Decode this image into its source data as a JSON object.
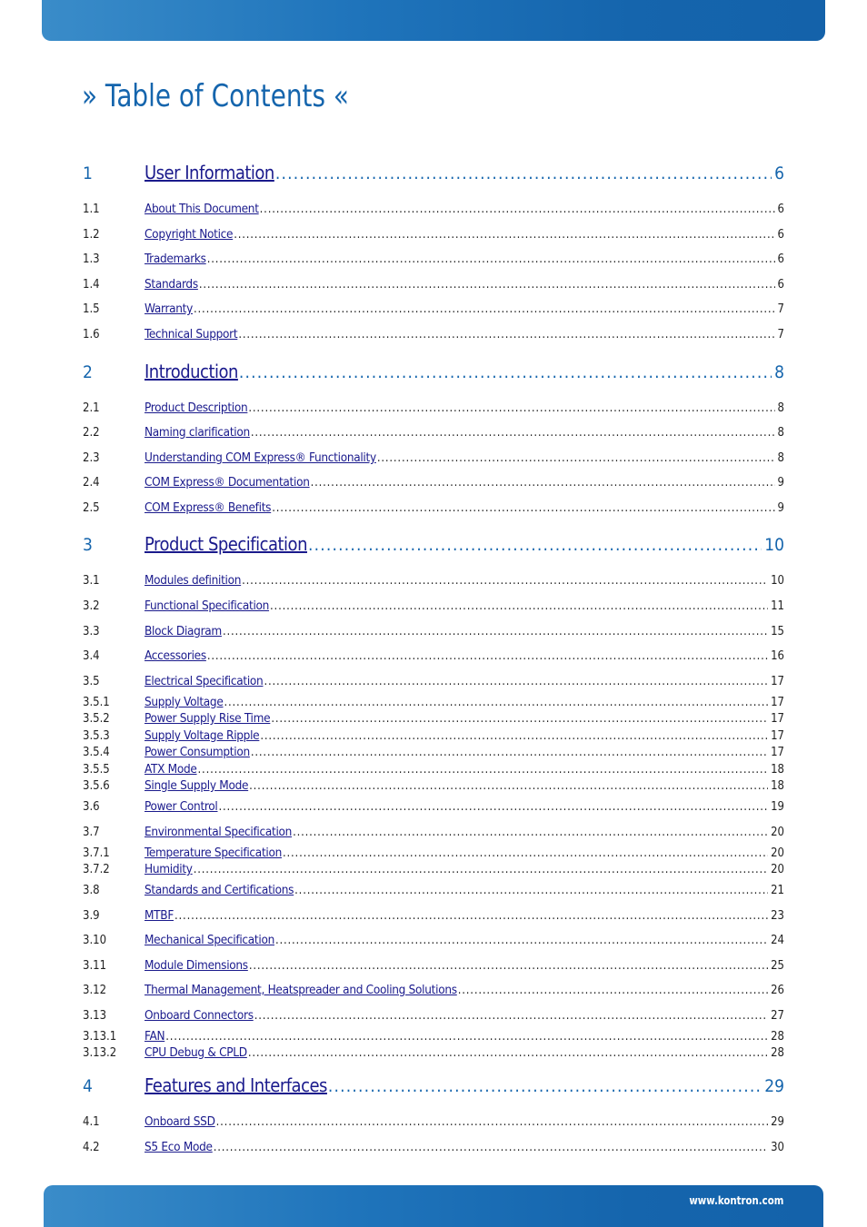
{
  "header": {
    "title": "» Table of Contents «"
  },
  "footer": {
    "url": "www.kontron.com"
  },
  "toc": [
    {
      "num": "1",
      "title": "User Information",
      "page": "6",
      "level": 1
    },
    {
      "num": "1.1",
      "title": "About This Document",
      "page": "6",
      "level": 2
    },
    {
      "num": "1.2",
      "title": "Copyright Notice",
      "page": "6",
      "level": 2
    },
    {
      "num": "1.3",
      "title": "Trademarks",
      "page": "6",
      "level": 2
    },
    {
      "num": "1.4",
      "title": "Standards",
      "page": "6",
      "level": 2
    },
    {
      "num": "1.5",
      "title": "Warranty",
      "page": "7",
      "level": 2
    },
    {
      "num": "1.6",
      "title": "Technical Support",
      "page": "7",
      "level": 2
    },
    {
      "num": "2",
      "title": "Introduction",
      "page": "8",
      "level": 1
    },
    {
      "num": "2.1",
      "title": "Product Description",
      "page": "8",
      "level": 2
    },
    {
      "num": "2.2",
      "title": "Naming clarification",
      "page": "8",
      "level": 2
    },
    {
      "num": "2.3",
      "title": "Understanding COM Express® Functionality",
      "page": "8",
      "level": 2
    },
    {
      "num": "2.4",
      "title": "COM Express® Documentation",
      "page": "9",
      "level": 2
    },
    {
      "num": "2.5",
      "title": "COM Express® Benefits",
      "page": "9",
      "level": 2
    },
    {
      "num": "3",
      "title": "Product Specification",
      "page": "10",
      "level": 1
    },
    {
      "num": "3.1",
      "title": "Modules definition",
      "page": "10",
      "level": 2
    },
    {
      "num": "3.2",
      "title": "Functional Specification",
      "page": "11",
      "level": 2
    },
    {
      "num": "3.3",
      "title": "Block Diagram",
      "page": "15",
      "level": 2
    },
    {
      "num": "3.4",
      "title": "Accessories",
      "page": "16",
      "level": 2
    },
    {
      "num": "3.5",
      "title": "Electrical Specification",
      "page": "17",
      "level": 2
    },
    {
      "num": "3.5.1",
      "title": "Supply Voltage",
      "page": "17",
      "level": 3
    },
    {
      "num": "3.5.2",
      "title": "Power Supply Rise Time",
      "page": "17",
      "level": 3
    },
    {
      "num": "3.5.3",
      "title": "Supply Voltage Ripple",
      "page": "17",
      "level": 3
    },
    {
      "num": "3.5.4",
      "title": "Power Consumption",
      "page": "17",
      "level": 3
    },
    {
      "num": "3.5.5",
      "title": "ATX Mode",
      "page": "18",
      "level": 3
    },
    {
      "num": "3.5.6",
      "title": "Single Supply Mode",
      "page": "18",
      "level": 3
    },
    {
      "num": "3.6",
      "title": "Power Control",
      "page": "19",
      "level": 2
    },
    {
      "num": "3.7",
      "title": "Environmental Specification",
      "page": "20",
      "level": 2
    },
    {
      "num": "3.7.1",
      "title": "Temperature Specification",
      "page": "20",
      "level": 3
    },
    {
      "num": "3.7.2",
      "title": "Humidity",
      "page": "20",
      "level": 3
    },
    {
      "num": "3.8",
      "title": "Standards and Certifications",
      "page": "21",
      "level": 2
    },
    {
      "num": "3.9",
      "title": "MTBF",
      "page": "23",
      "level": 2
    },
    {
      "num": "3.10",
      "title": "Mechanical Specification",
      "page": "24",
      "level": 2
    },
    {
      "num": "3.11",
      "title": "Module Dimensions",
      "page": "25",
      "level": 2
    },
    {
      "num": "3.12",
      "title": "Thermal Management, Heatspreader and Cooling Solutions",
      "page": "26",
      "level": 2
    },
    {
      "num": "3.13",
      "title": "Onboard Connectors",
      "page": "27",
      "level": 2
    },
    {
      "num": "3.13.1",
      "title": "FAN",
      "page": "28",
      "level": 3
    },
    {
      "num": "3.13.2",
      "title": "CPU Debug & CPLD",
      "page": "28",
      "level": 3
    },
    {
      "num": "4",
      "title": "Features and Interfaces",
      "page": "29",
      "level": 1
    },
    {
      "num": "4.1",
      "title": "Onboard SSD",
      "page": "29",
      "level": 2
    },
    {
      "num": "4.2",
      "title": "S5 Eco Mode",
      "page": "30",
      "level": 2
    }
  ]
}
